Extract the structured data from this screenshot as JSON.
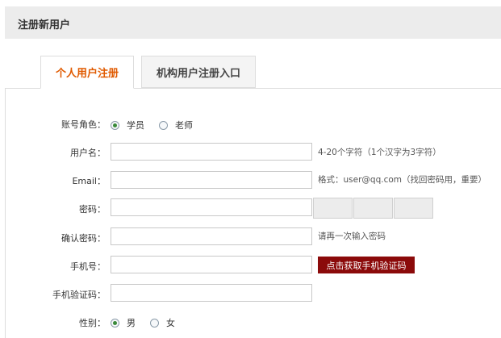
{
  "header": {
    "title": "注册新用户"
  },
  "tabs": [
    {
      "label": "个人用户注册",
      "active": true
    },
    {
      "label": "机构用户注册入口",
      "active": false
    }
  ],
  "form": {
    "role": {
      "label": "账号角色：",
      "options": [
        "学员",
        "老师"
      ],
      "selected": "学员"
    },
    "username": {
      "label": "用户名：",
      "value": "",
      "hint": "4-20个字符（1个汉字为3字符）"
    },
    "email": {
      "label": "Email：",
      "value": "",
      "hint": "格式：user@qq.com（找回密码用，重要）"
    },
    "password": {
      "label": "密码：",
      "value": ""
    },
    "confirm_password": {
      "label": "确认密码：",
      "value": "",
      "hint": "请再一次输入密码"
    },
    "phone": {
      "label": "手机号：",
      "value": "",
      "button_label": "点击获取手机验证码"
    },
    "sms_code": {
      "label": "手机验证码：",
      "value": ""
    },
    "gender": {
      "label": "性别：",
      "options": [
        "男",
        "女"
      ],
      "selected": "男"
    }
  },
  "colors": {
    "active_tab": "#e05a00",
    "sms_button": "#8b0a0a",
    "radio_selected": "#3a8a3a"
  }
}
